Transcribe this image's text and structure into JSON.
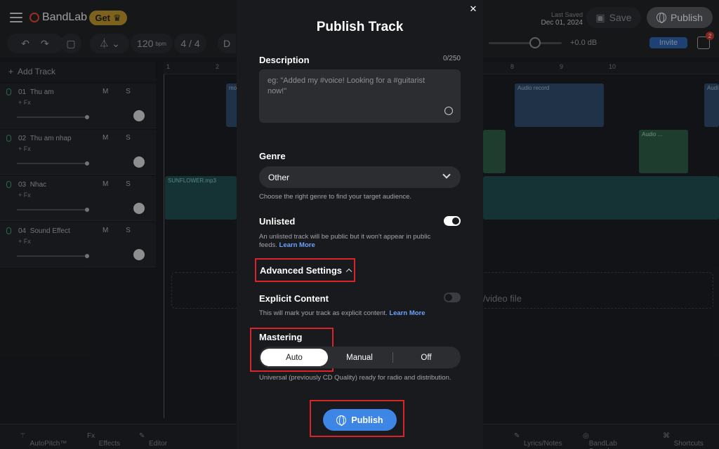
{
  "header": {
    "logo_text": "BandLab",
    "get_label": "Get",
    "last_saved_label": "Last Saved",
    "last_saved_date": "Dec 01, 2024",
    "save_label": "Save",
    "publish_label": "Publish",
    "invite_label": "Invite",
    "notification_count": "2"
  },
  "toolbar": {
    "bpm": "120",
    "bpm_unit": "bpm",
    "time_signature": "4 / 4",
    "key": "D",
    "volume_db": "+0.0 dB"
  },
  "tracks_panel": {
    "add_track_label": "Add Track",
    "fx_label": "+ Fx",
    "mute_solo": "M S",
    "tracks": [
      {
        "number": "01",
        "name": "Thu am"
      },
      {
        "number": "02",
        "name": "Thu am nhap"
      },
      {
        "number": "03",
        "name": "Nhac"
      },
      {
        "number": "04",
        "name": "Sound Effect"
      }
    ]
  },
  "timeline": {
    "ruler": [
      "1",
      "2",
      "8",
      "9",
      "10"
    ],
    "clips": [
      "mo",
      "Audio record",
      "Audi",
      "Audio ...",
      "SUNFLOWER.mp3"
    ],
    "drop_text": "/video file"
  },
  "bottom_bar": {
    "autopitch": "AutoPitch™",
    "effects": "Effects",
    "editor": "Editor",
    "lyrics": "Lyrics/Notes",
    "sounds": "BandLab Sounds",
    "shortcuts": "Shortcuts"
  },
  "modal": {
    "title": "Publish Track",
    "description_label": "Description",
    "description_counter": "0/250",
    "description_placeholder": "eg: \"Added my #voice! Looking for a #guitarist now!\"",
    "genre_label": "Genre",
    "genre_value": "Other",
    "genre_hint": "Choose the right genre to find your target audience.",
    "unlisted_label": "Unlisted",
    "unlisted_on": true,
    "unlisted_hint": "An unlisted track will be public but it won't appear in public feeds.",
    "learn_more": "Learn More",
    "advanced_label": "Advanced Settings",
    "explicit_label": "Explicit Content",
    "explicit_on": false,
    "explicit_hint": "This will mark your track as explicit content.",
    "mastering_label": "Mastering",
    "mastering_options": [
      "Auto",
      "Manual",
      "Off"
    ],
    "mastering_selected": "Auto",
    "mastering_hint": "Universal (previously CD Quality) ready for radio and distribution.",
    "publish_label": "Publish"
  },
  "colors": {
    "accent_blue": "#3d86e6",
    "highlight_red": "#d9252a",
    "modal_bg": "#191a1d"
  }
}
